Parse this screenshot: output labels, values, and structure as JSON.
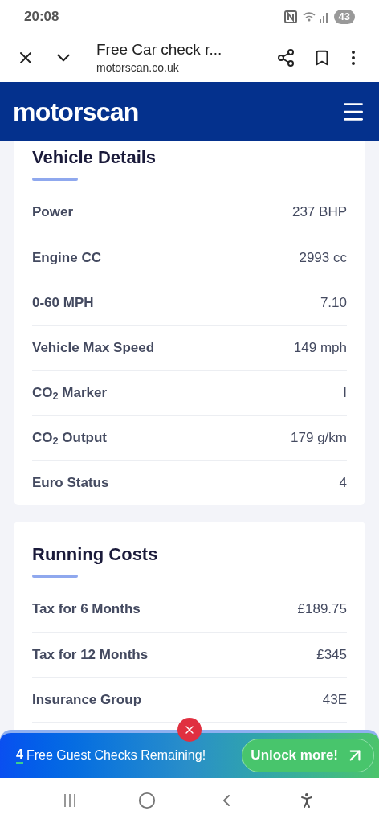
{
  "status_bar": {
    "time": "20:08",
    "battery": "43"
  },
  "browser": {
    "title": "Free Car check r...",
    "url": "motorscan.co.uk"
  },
  "header": {
    "logo": "motorscan"
  },
  "sections": [
    {
      "title": "Vehicle Details",
      "rows": [
        {
          "label": "Power",
          "value": "237 BHP"
        },
        {
          "label": "Engine CC",
          "value": "2993 cc"
        },
        {
          "label": "0-60 MPH",
          "value": "7.10"
        },
        {
          "label": "Vehicle Max Speed",
          "value": "149 mph"
        },
        {
          "label": "CO$_{2}$ Marker",
          "value": "I"
        },
        {
          "label": "CO$_{2}$ Output",
          "value": "179 g/km"
        },
        {
          "label": "Euro Status",
          "value": "4"
        }
      ]
    },
    {
      "title": "Running Costs",
      "rows": [
        {
          "label": "Tax for 6 Months",
          "value": "£189.75"
        },
        {
          "label": "Tax for 12 Months",
          "value": "£345"
        },
        {
          "label": "Insurance Group",
          "value": "43E"
        }
      ]
    }
  ],
  "banner": {
    "count": "4",
    "text": "Free Guest Checks Remaining!",
    "button": "Unlock more!"
  }
}
